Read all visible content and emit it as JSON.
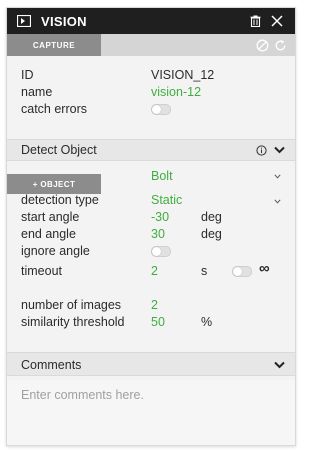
{
  "window": {
    "title": "VISION"
  },
  "capture_bar": {
    "capture_label": "CAPTURE"
  },
  "properties": {
    "id_label": "ID",
    "id_value": "VISION_12",
    "name_label": "name",
    "name_value": "vision-12",
    "catch_errors_label": "catch errors"
  },
  "detect_section": {
    "title": "Detect Object",
    "object_button_label": "+ OBJECT",
    "object_value": "Bolt",
    "detection_type_label": "detection type",
    "detection_type_value": "Static",
    "start_angle_label": "start angle",
    "start_angle_value": "-30",
    "start_angle_unit": "deg",
    "end_angle_label": "end angle",
    "end_angle_value": "30",
    "end_angle_unit": "deg",
    "ignore_angle_label": "ignore angle",
    "timeout_label": "timeout",
    "timeout_value": "2",
    "timeout_unit": "s",
    "infinity_symbol": "∞",
    "number_of_images_label": "number of images",
    "number_of_images_value": "2",
    "similarity_threshold_label": "similarity threshold",
    "similarity_threshold_value": "50",
    "similarity_threshold_unit": "%"
  },
  "comments_section": {
    "title": "Comments",
    "placeholder": "Enter comments here."
  },
  "colors": {
    "accent_green": "#3fae3f",
    "titlebar": "#1f1f1f",
    "button_gray": "#8c8c8c"
  },
  "icons": [
    "vision-app-icon",
    "trash-icon",
    "close-icon",
    "cancel-icon",
    "refresh-icon",
    "info-icon",
    "chevron-down-icon",
    "infinity-icon"
  ]
}
